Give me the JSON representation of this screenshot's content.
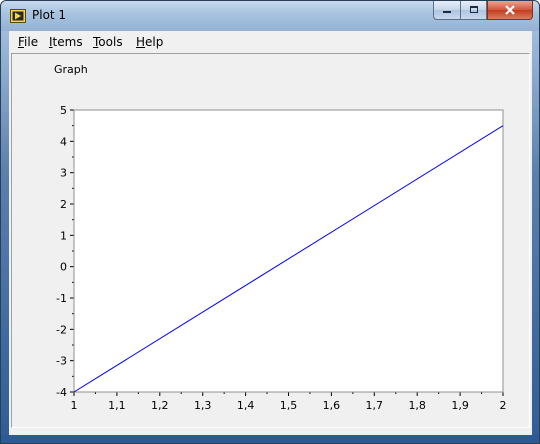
{
  "window": {
    "title": "Plot 1"
  },
  "menu": {
    "file": {
      "underlined": "F",
      "rest": "ile"
    },
    "items": {
      "underlined": "I",
      "rest": "tems"
    },
    "tools": {
      "underlined": "T",
      "rest": "ools"
    },
    "help": {
      "underlined": "H",
      "rest": "elp"
    }
  },
  "graph": {
    "label": "Graph"
  },
  "chart_data": {
    "type": "line",
    "title": "Graph",
    "xlabel": "",
    "ylabel": "",
    "xlim": [
      1,
      2
    ],
    "ylim": [
      -4,
      5
    ],
    "x_ticks": [
      "1",
      "1,1",
      "1,2",
      "1,3",
      "1,4",
      "1,5",
      "1,6",
      "1,7",
      "1,8",
      "1,9",
      "2"
    ],
    "y_ticks": [
      "5",
      "4",
      "3",
      "2",
      "1",
      "0",
      "-1",
      "-2",
      "-3",
      "-4"
    ],
    "grid": false,
    "series": [
      {
        "x": [
          1,
          2
        ],
        "y": [
          -4,
          4.5
        ],
        "color": "#0000ff"
      }
    ]
  },
  "colors": {
    "plot_background": "#ffffff",
    "line": "#0000ff",
    "panel": "#f0f0f0"
  }
}
